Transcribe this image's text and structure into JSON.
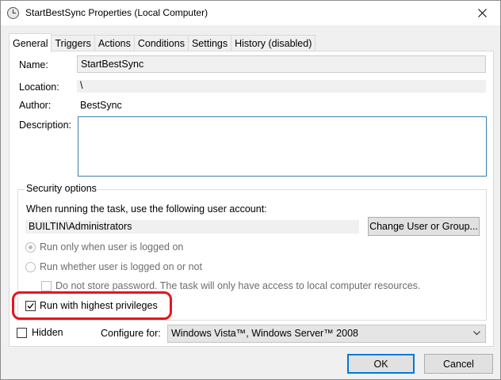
{
  "window": {
    "title": "StartBestSync Properties (Local Computer)",
    "icon": "clock-icon"
  },
  "tabs": [
    {
      "label": "General",
      "active": true
    },
    {
      "label": "Triggers",
      "active": false
    },
    {
      "label": "Actions",
      "active": false
    },
    {
      "label": "Conditions",
      "active": false
    },
    {
      "label": "Settings",
      "active": false
    },
    {
      "label": "History (disabled)",
      "active": false
    }
  ],
  "general": {
    "name_label": "Name:",
    "name_value": "StartBestSync",
    "location_label": "Location:",
    "location_value": "\\",
    "author_label": "Author:",
    "author_value": "BestSync",
    "description_label": "Description:",
    "description_value": ""
  },
  "security": {
    "title": "Security options",
    "account_prompt": "When running the task, use the following user account:",
    "account_value": "BUILTIN\\Administrators",
    "change_button": "Change User or Group...",
    "radio_logged_on": "Run only when user is logged on",
    "radio_whether": "Run whether user is logged on or not",
    "no_store_password": "Do not store password.  The task will only have access to local computer resources.",
    "highest_privileges": "Run with highest privileges",
    "highest_privileges_checked": true
  },
  "bottom": {
    "hidden_label": "Hidden",
    "hidden_checked": false,
    "configure_label": "Configure for:",
    "configure_value": "Windows Vista™, Windows Server™ 2008"
  },
  "buttons": {
    "ok": "OK",
    "cancel": "Cancel"
  },
  "colors": {
    "highlight": "#e8141c",
    "focus_border": "#3c7fb1",
    "default_button": "#0078d7"
  }
}
